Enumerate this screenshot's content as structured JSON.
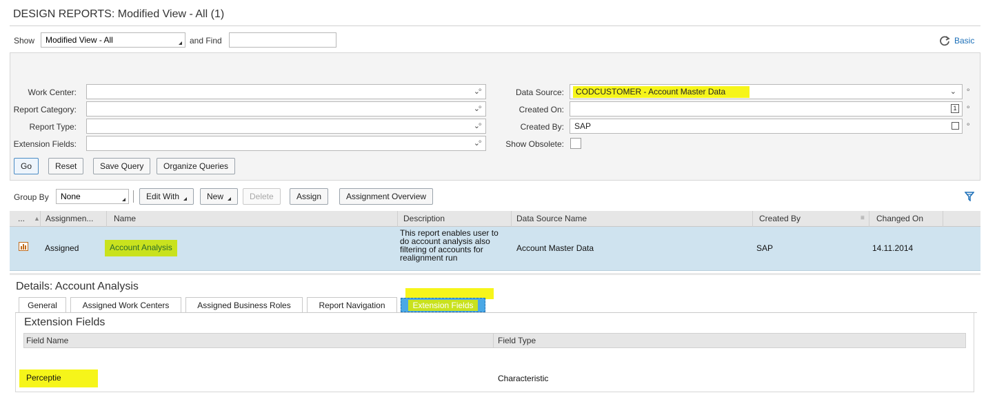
{
  "page": {
    "title": "DESIGN REPORTS: Modified View - All (1)"
  },
  "toolbar": {
    "show_label": "Show",
    "show_value": "Modified View - All",
    "find_label": "and Find",
    "find_value": "",
    "basic_label": "Basic"
  },
  "filters": {
    "work_center_label": "Work Center:",
    "work_center_value": "",
    "report_category_label": "Report Category:",
    "report_category_value": "",
    "report_type_label": "Report Type:",
    "report_type_value": "",
    "extension_fields_label": "Extension Fields:",
    "extension_fields_value": "",
    "data_source_label": "Data Source:",
    "data_source_value": "CODCUSTOMER - Account Master Data",
    "created_on_label": "Created On:",
    "created_on_value": "",
    "created_by_label": "Created By:",
    "created_by_value": "SAP",
    "show_obsolete_label": "Show Obsolete:",
    "show_obsolete_checked": false,
    "buttons": {
      "go": "Go",
      "reset": "Reset",
      "save_query": "Save Query",
      "organize_queries": "Organize Queries"
    }
  },
  "list_toolbar": {
    "group_by_label": "Group By",
    "group_by_value": "None",
    "edit_with": "Edit With",
    "new": "New",
    "delete": "Delete",
    "assign": "Assign",
    "assignment_overview": "Assignment Overview"
  },
  "table": {
    "headers": {
      "more": "...",
      "assignment": "Assignmen...",
      "name": "Name",
      "description": "Description",
      "data_source_name": "Data Source Name",
      "created_by": "Created By",
      "changed_on": "Changed On"
    },
    "rows": [
      {
        "assignment": "Assigned",
        "name": "Account Analysis",
        "description_lines": [
          "This report enables user to",
          "do account analysis also",
          "filtering of accounts for",
          "realignment run"
        ],
        "data_source_name": "Account Master Data",
        "created_by": "SAP",
        "changed_on": "14.11.2014"
      }
    ]
  },
  "details": {
    "title": "Details: Account Analysis",
    "tabs": [
      "General",
      "Assigned Work Centers",
      "Assigned Business Roles",
      "Report Navigation",
      "Extension Fields"
    ],
    "active_tab": "Extension Fields",
    "section_title": "Extension Fields",
    "columns": {
      "field_name": "Field Name",
      "field_type": "Field Type"
    },
    "rows": [
      {
        "field_name": "Perceptie",
        "field_type": "Characteristic"
      }
    ]
  },
  "colors": {
    "selected_row": "#cfe3ef",
    "highlight_yellow": "#f6f51a",
    "highlight_green": "#c9e21e",
    "active_tab": "#4aa8e6",
    "link_blue": "#1b6fb8"
  },
  "icons": {
    "refresh": "refresh-icon",
    "filter": "filter-icon",
    "report": "report-icon",
    "value_help": "value-help-icon",
    "calendar": "calendar-icon",
    "copy": "copy-icon"
  }
}
